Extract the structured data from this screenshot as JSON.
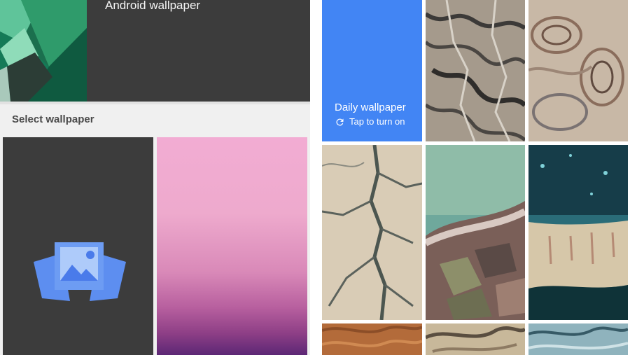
{
  "left_screen": {
    "current_wallpaper": {
      "title": "Android wallpaper"
    },
    "section_title": "Select wallpaper",
    "tiles": [
      {
        "kind": "pick-image",
        "icon": "gallery-icon"
      },
      {
        "kind": "gradient",
        "colors": [
          "#f2acd3",
          "#d989b8",
          "#5c2775"
        ]
      }
    ]
  },
  "right_screen": {
    "daily": {
      "title": "Daily wallpaper",
      "subtitle": "Tap to turn on",
      "icon": "refresh-icon",
      "color": "#4285f4"
    },
    "tiles": [
      {
        "name": "satellite-wallpaper-canyons"
      },
      {
        "name": "satellite-wallpaper-swirls"
      },
      {
        "name": "satellite-wallpaper-riverbed"
      },
      {
        "name": "satellite-wallpaper-salt-fields"
      },
      {
        "name": "satellite-wallpaper-coast-aerial"
      },
      {
        "name": "satellite-wallpaper-dunes"
      },
      {
        "name": "satellite-wallpaper-sand-rocks"
      },
      {
        "name": "satellite-wallpaper-blue-terrain"
      }
    ]
  }
}
